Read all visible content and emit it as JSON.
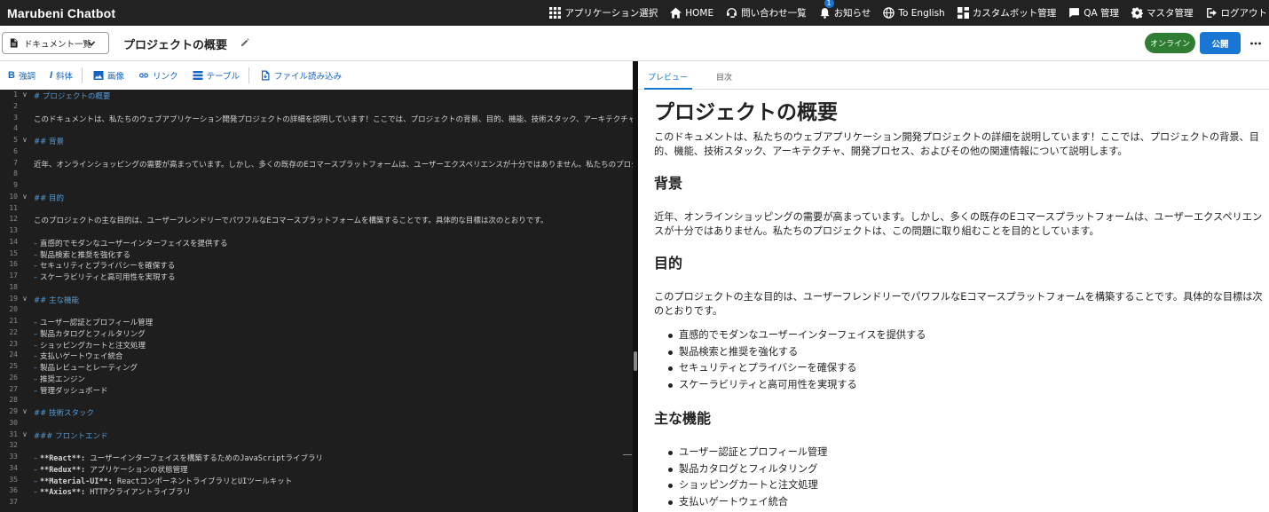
{
  "app": {
    "brand": "Marubeni Chatbot"
  },
  "nav": [
    {
      "label": "アプリケーション選択",
      "icon": "grid-icon"
    },
    {
      "label": "HOME",
      "icon": "home-icon"
    },
    {
      "label": "問い合わせ一覧",
      "icon": "support-icon"
    },
    {
      "label": "お知らせ",
      "icon": "bell-icon",
      "badge": "1"
    },
    {
      "label": "To English",
      "icon": "globe-icon"
    },
    {
      "label": "カスタムボット管理",
      "icon": "dashboard-icon"
    },
    {
      "label": "QA 管理",
      "icon": "chat-icon"
    },
    {
      "label": "マスタ管理",
      "icon": "gear-icon"
    },
    {
      "label": "ログアウト",
      "icon": "logout-icon"
    }
  ],
  "docbar": {
    "doc_select_label": "ドキュメント一覧",
    "title": "プロジェクトの概要",
    "online_label": "オンライン",
    "publish_label": "公開"
  },
  "toolbar": {
    "bold": "強調",
    "italic": "斜体",
    "image": "画像",
    "link": "リンク",
    "table": "テーブル",
    "file_import": "ファイル読み込み"
  },
  "editor": {
    "lines": [
      {
        "n": "1",
        "fold": true,
        "kind": "h",
        "text": "# プロジェクトの概要"
      },
      {
        "n": "2",
        "kind": "p",
        "text": ""
      },
      {
        "n": "3",
        "kind": "p",
        "text": "このドキュメントは、私たちのウェブアプリケーション開発プロジェクトの詳細を説明しています！ここでは、プロジェクトの背景、目的、機能、技術スタック、アーキテクチャ、開発プロセス、およびそ"
      },
      {
        "n": "4",
        "kind": "p",
        "text": ""
      },
      {
        "n": "5",
        "fold": true,
        "kind": "h",
        "text": "## 背景"
      },
      {
        "n": "6",
        "kind": "p",
        "text": ""
      },
      {
        "n": "7",
        "kind": "p",
        "text": "近年、オンラインショッピングの需要が高まっています。しかし、多くの既存のEコマースプラットフォームは、ユーザーエクスペリエンスが十分ではありません。私たちのプロジェクトは、この問題に"
      },
      {
        "n": "8",
        "kind": "p",
        "text": ""
      },
      {
        "n": "9",
        "kind": "p",
        "text": ""
      },
      {
        "n": "10",
        "fold": true,
        "kind": "h",
        "text": "## 目的"
      },
      {
        "n": "11",
        "kind": "p",
        "text": ""
      },
      {
        "n": "12",
        "kind": "p",
        "text": "このプロジェクトの主な目的は、ユーザーフレンドリーでパワフルなEコマースプラットフォームを構築することです。具体的な目標は次のとおりです。"
      },
      {
        "n": "13",
        "kind": "p",
        "text": ""
      },
      {
        "n": "14",
        "kind": "li",
        "text": "直感的でモダンなユーザーインターフェイスを提供する"
      },
      {
        "n": "15",
        "kind": "li",
        "text": "製品検索と推奨を強化する"
      },
      {
        "n": "16",
        "kind": "li",
        "text": "セキュリティとプライバシーを確保する"
      },
      {
        "n": "17",
        "kind": "li",
        "text": "スケーラビリティと高可用性を実現する"
      },
      {
        "n": "18",
        "kind": "p",
        "text": ""
      },
      {
        "n": "19",
        "fold": true,
        "kind": "h",
        "text": "## 主な機能"
      },
      {
        "n": "20",
        "kind": "p",
        "text": ""
      },
      {
        "n": "21",
        "kind": "li",
        "text": "ユーザー認証とプロフィール管理"
      },
      {
        "n": "22",
        "kind": "li",
        "text": "製品カタログとフィルタリング"
      },
      {
        "n": "23",
        "kind": "li",
        "text": "ショッピングカートと注文処理"
      },
      {
        "n": "24",
        "kind": "li",
        "text": "支払いゲートウェイ統合"
      },
      {
        "n": "25",
        "kind": "li",
        "text": "製品レビューとレーティング"
      },
      {
        "n": "26",
        "kind": "li",
        "text": "推奨エンジン"
      },
      {
        "n": "27",
        "kind": "li",
        "text": "管理ダッシュボード"
      },
      {
        "n": "28",
        "kind": "p",
        "text": ""
      },
      {
        "n": "29",
        "fold": true,
        "kind": "h",
        "text": "## 技術スタック"
      },
      {
        "n": "30",
        "kind": "p",
        "text": ""
      },
      {
        "n": "31",
        "fold": true,
        "kind": "h",
        "text": "### フロントエンド"
      },
      {
        "n": "32",
        "kind": "p",
        "text": ""
      },
      {
        "n": "33",
        "kind": "bli",
        "bold": "**React**:",
        "text": " ユーザーインターフェイスを構築するためのJavaScriptライブラリ"
      },
      {
        "n": "34",
        "kind": "bli",
        "bold": "**Redux**:",
        "text": " アプリケーションの状態管理"
      },
      {
        "n": "35",
        "kind": "bli",
        "bold": "**Material-UI**:",
        "text": " ReactコンポーネントライブラリとUIツールキット"
      },
      {
        "n": "36",
        "kind": "bli",
        "bold": "**Axios**:",
        "text": " HTTPクライアントライブラリ"
      },
      {
        "n": "37",
        "kind": "p",
        "text": ""
      }
    ]
  },
  "preview_tabs": {
    "preview": "プレビュー",
    "toc": "目次"
  },
  "preview": {
    "h1": "プロジェクトの概要",
    "intro": "このドキュメントは、私たちのウェブアプリケーション開発プロジェクトの詳細を説明しています！ここでは、プロジェクトの背景、目的、機能、技術スタック、アーキテクチャ、開発プロセス、およびその他の関連情報について説明します。",
    "h2_background": "背景",
    "background": "近年、オンラインショッピングの需要が高まっています。しかし、多くの既存のEコマースプラットフォームは、ユーザーエクスペリエンスが十分ではありません。私たちのプロジェクトは、この問題に取り組むことを目的としています。",
    "h2_purpose": "目的",
    "purpose": "このプロジェクトの主な目的は、ユーザーフレンドリーでパワフルなEコマースプラットフォームを構築することです。具体的な目標は次のとおりです。",
    "purpose_items": [
      "直感的でモダンなユーザーインターフェイスを提供する",
      "製品検索と推奨を強化する",
      "セキュリティとプライバシーを確保する",
      "スケーラビリティと高可用性を実現する"
    ],
    "h2_features": "主な機能",
    "feature_items": [
      "ユーザー認証とプロフィール管理",
      "製品カタログとフィルタリング",
      "ショッピングカートと注文処理",
      "支払いゲートウェイ統合"
    ]
  }
}
